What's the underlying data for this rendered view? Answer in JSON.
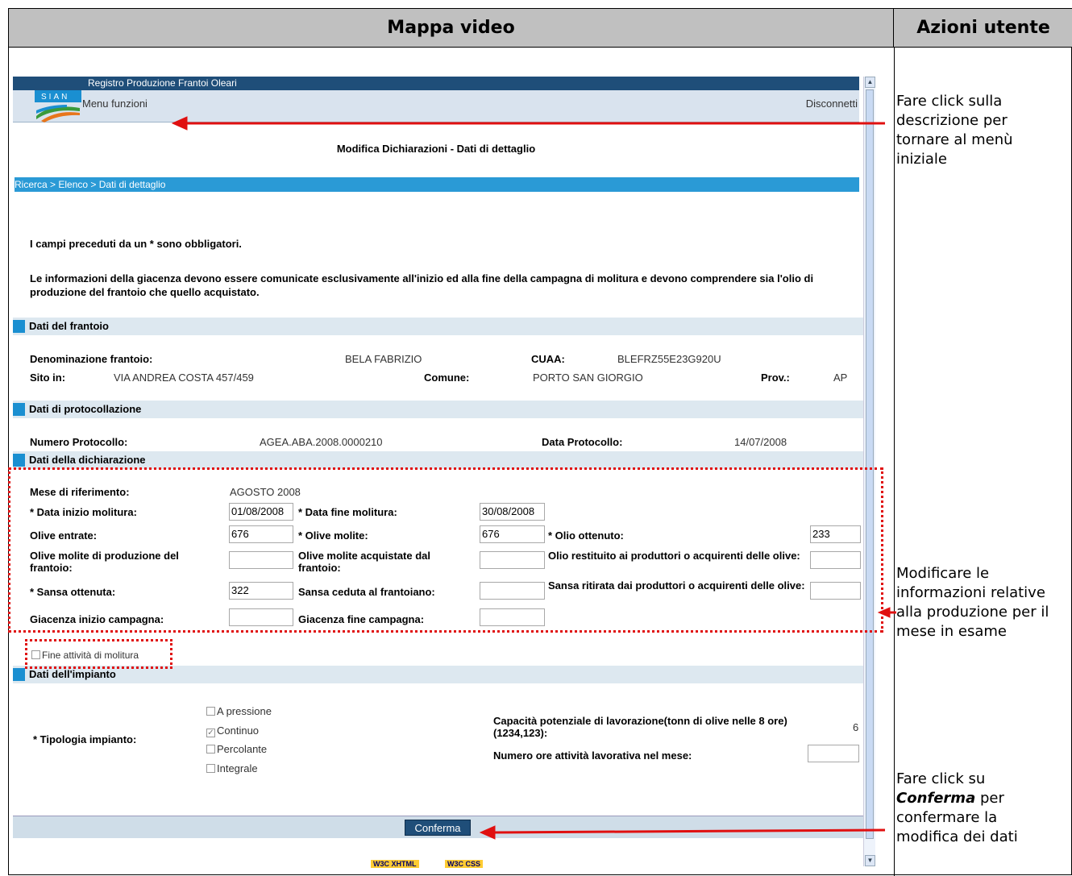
{
  "header": {
    "left": "Mappa video",
    "right": "Azioni utente"
  },
  "notes": {
    "n1": "Fare click sulla descrizione per tornare al menù iniziale",
    "n2": "Modificare  le informazioni relative alla produzione per il mese in esame",
    "n3_pre": "Fare click su",
    "n3_bold": "Conferma",
    "n3_post": "per confermare la modifica dei dati"
  },
  "app": {
    "title": "Registro Produzione Frantoi Oleari",
    "logo": "SIAN",
    "menu": "Menu funzioni",
    "logout": "Disconnetti",
    "page_title": "Modifica Dichiarazioni - Dati di dettaglio",
    "crumb": [
      "Ricerca",
      "Elenco",
      "Dati di dettaglio"
    ],
    "crumb_sep": " > ",
    "info1": "I campi preceduti da un * sono obbligatori.",
    "info2": "Le informazioni della giacenza devono essere comunicate esclusivamente all'inizio ed alla fine della campagna di molitura e devono comprendere sia l'olio di produzione del frantoio che quello acquistato.",
    "sec_frantoio": "Dati del frantoio",
    "denominazione_l": "Denominazione frantoio:",
    "denominazione_v": "BELA FABRIZIO",
    "cuaa_l": "CUAA:",
    "cuaa_v": "BLEFRZ55E23G920U",
    "sito_l": "Sito in:",
    "sito_v": "VIA ANDREA COSTA 457/459",
    "comune_l": "Comune:",
    "comune_v": "PORTO SAN GIORGIO",
    "prov_l": "Prov.:",
    "prov_v": "AP",
    "sec_protocollo": "Dati di protocollazione",
    "numprot_l": "Numero Protocollo:",
    "numprot_v": "AGEA.ABA.2008.0000210",
    "dataprot_l": "Data Protocollo:",
    "dataprot_v": "14/07/2008",
    "sec_dich": "Dati della dichiarazione",
    "mese_l": "Mese di riferimento:",
    "mese_v": "AGOSTO 2008",
    "inizio_l": "* Data inizio molitura:",
    "inizio_v": "01/08/2008",
    "fine_l": "* Data fine molitura:",
    "fine_v": "30/08/2008",
    "entrate_l": "Olive entrate:",
    "entrate_v": "676",
    "molite_l": "* Olive molite:",
    "molite_v": "676",
    "olio_l": "* Olio ottenuto:",
    "olio_v": "233",
    "molprod_l": "Olive molite di produzione del frantoio:",
    "molacq_l": "Olive molite acquistate dal frantoio:",
    "olrest_l": "Olio restituito ai produttori o acquirenti delle olive:",
    "sansa_l": "* Sansa ottenuta:",
    "sansa_v": "322",
    "sansaced_l": "Sansa ceduta al frantoiano:",
    "sansarit_l": "Sansa ritirata dai produttori o acquirenti delle olive:",
    "giacini_l": "Giacenza inizio campagna:",
    "giacfin_l": "Giacenza fine campagna:",
    "fine_att": "Fine attività di molitura",
    "sec_impianto": "Dati dell'impianto",
    "tipologia_l": "* Tipologia impianto:",
    "opt1": "A pressione",
    "opt2": "Continuo",
    "opt3": "Percolante",
    "opt4": "Integrale",
    "capacita_l": "Capacità potenziale di lavorazione(tonn di olive nelle 8 ore) (1234,123):",
    "capacita_v": "6",
    "ore_l": "Numero ore attività lavorativa nel mese:",
    "confirm": "Conferma",
    "w3c1": "W3C XHTML",
    "w3c2": "W3C CSS"
  },
  "colors": {
    "accent": "#1f4e79",
    "arrow": "#e01010"
  }
}
